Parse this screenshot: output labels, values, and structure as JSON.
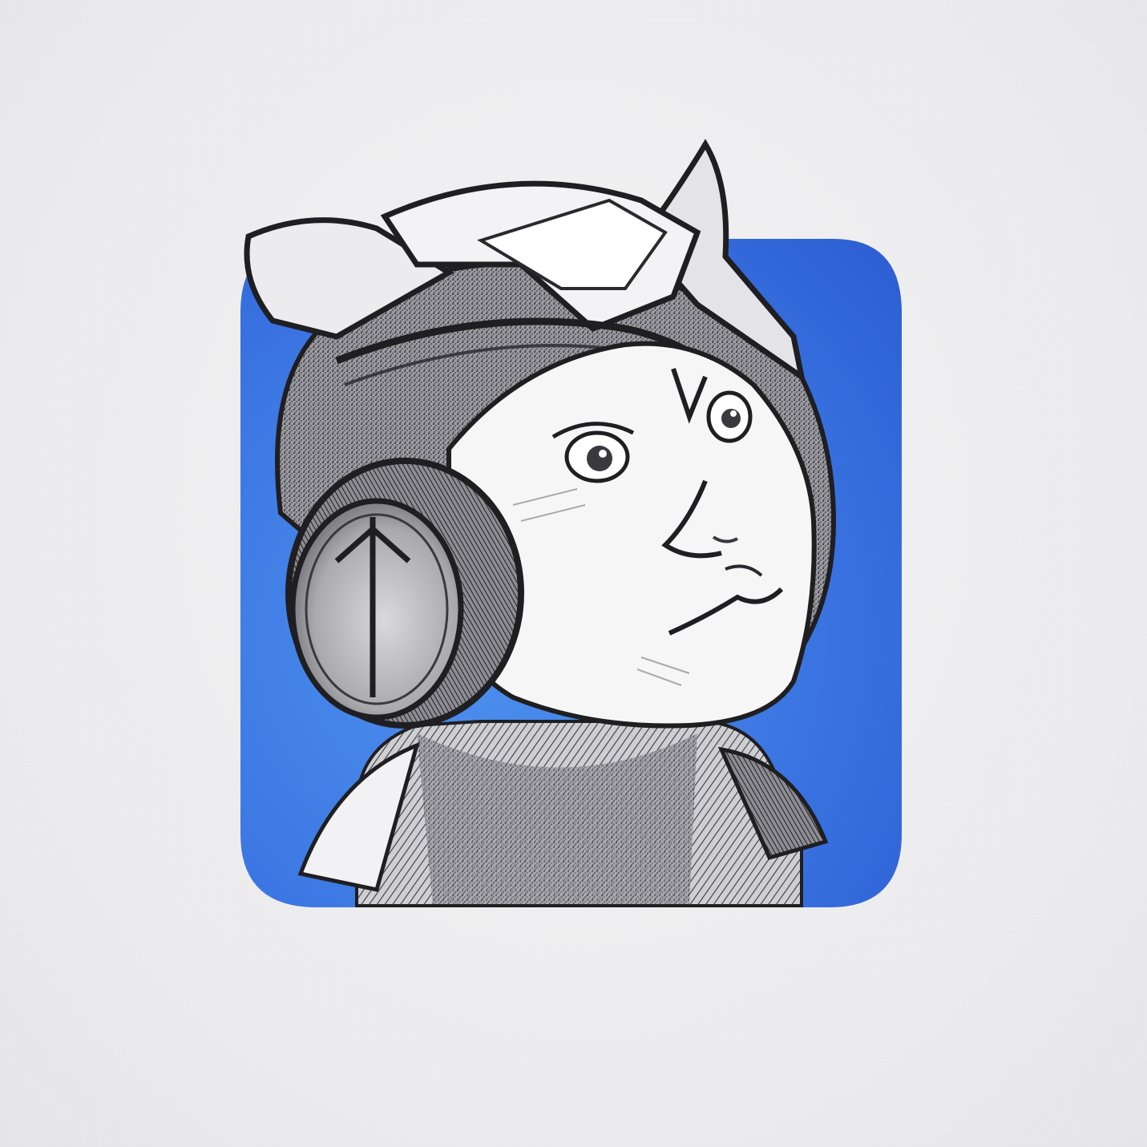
{
  "artwork": {
    "subject": "sketch-of-helmeted-character",
    "style": "pencil-sketch",
    "colors": {
      "paper": "#efeff0",
      "tile_light": "#4a8be8",
      "tile_dark": "#2f63d6",
      "graphite": "#1f1f22",
      "graphite_mid": "#55555a",
      "skin_paper": "#f6f6f7"
    },
    "icons": [
      "app-icon-tile",
      "peace-symbol-icon"
    ]
  }
}
